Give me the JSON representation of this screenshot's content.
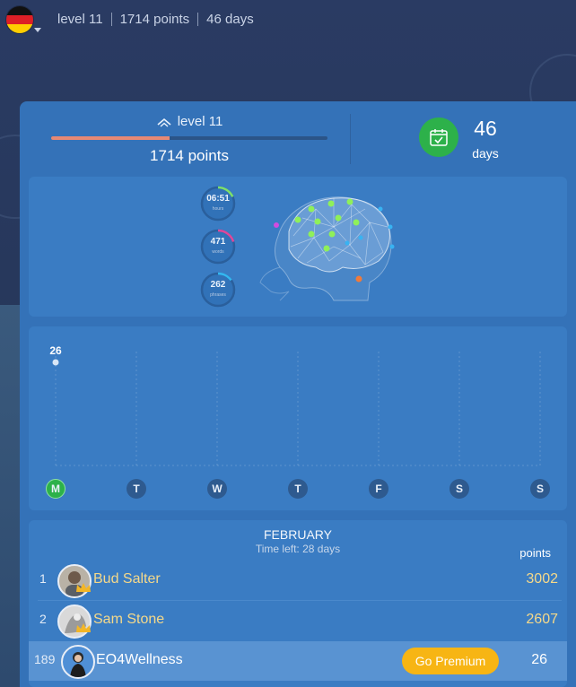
{
  "header": {
    "level": "level 11",
    "points": "1714 points",
    "days": "46 days"
  },
  "progress": {
    "level_label": "level 11",
    "points_label": "1714 points",
    "level_progress_fraction": 0.43,
    "days_value": "46",
    "days_label": "days"
  },
  "brain_stats": [
    {
      "value": "06:51",
      "label": "hours",
      "color": "#7ee06a",
      "fraction": 0.18
    },
    {
      "value": "471",
      "label": "words",
      "color": "#e0479a",
      "fraction": 0.2
    },
    {
      "value": "262",
      "label": "phrases",
      "color": "#33b7f0",
      "fraction": 0.15
    }
  ],
  "weekly_chart": {
    "days": [
      "M",
      "T",
      "W",
      "T",
      "F",
      "S",
      "S"
    ],
    "active_index": 0,
    "value_label": "26",
    "values": [
      26,
      0,
      0,
      0,
      0,
      0,
      0
    ]
  },
  "leaderboard": {
    "month": "FEBRUARY",
    "time_left": "Time left: 28 days",
    "points_header": "points",
    "rows": [
      {
        "rank": "1",
        "name": "Bud Salter",
        "score": "3002"
      },
      {
        "rank": "2",
        "name": "Sam Stone",
        "score": "2607"
      }
    ],
    "me": {
      "rank": "189",
      "name": "EO4Wellness",
      "score": "26",
      "cta": "Go Premium"
    }
  },
  "colors": {
    "accent_green": "#2db14a",
    "gold": "#f5d98a",
    "premium": "#f7b514",
    "panel": "#3472b8"
  }
}
